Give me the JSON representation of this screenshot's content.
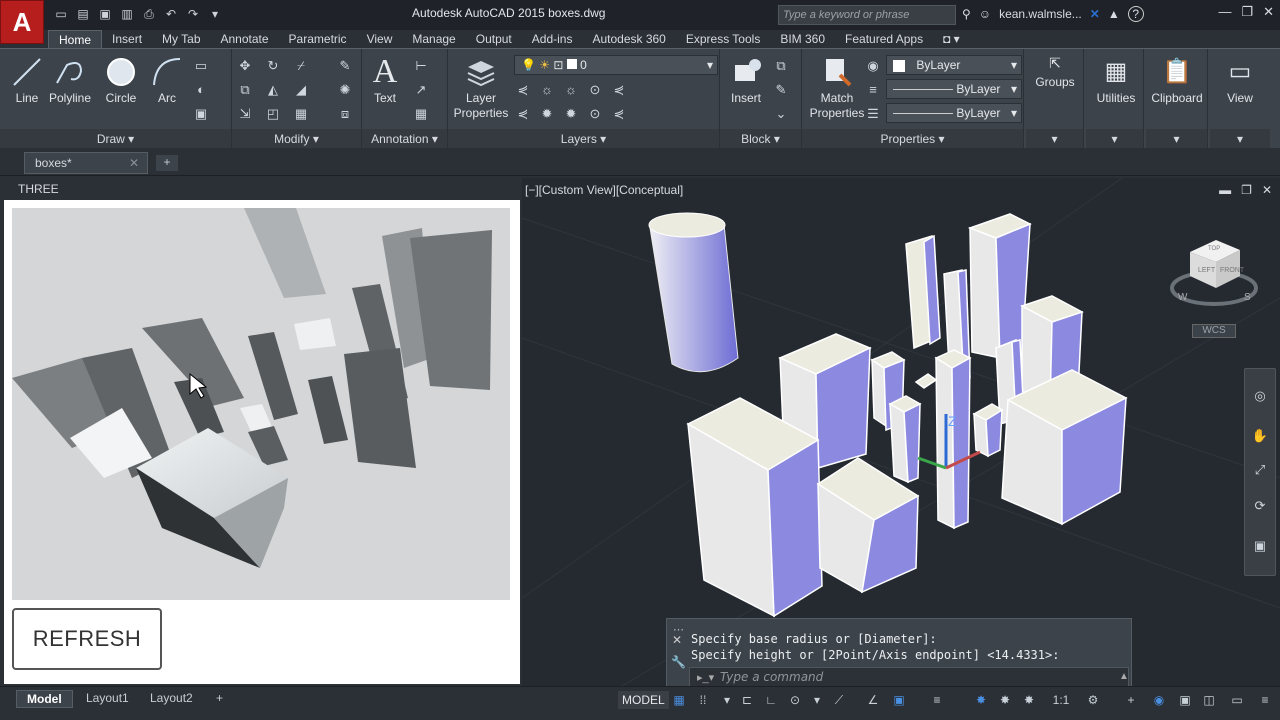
{
  "app": {
    "title": "Autodesk AutoCAD 2015    boxes.dwg",
    "logo_letter": "A",
    "search_placeholder": "Type a keyword or phrase",
    "user": "kean.walmsle...",
    "help": "?"
  },
  "ribbon_tabs": [
    "Home",
    "Insert",
    "My Tab",
    "Annotate",
    "Parametric",
    "View",
    "Manage",
    "Output",
    "Add-ins",
    "Autodesk 360",
    "Express Tools",
    "BIM 360",
    "Featured Apps"
  ],
  "ribbon": {
    "draw": {
      "title": "Draw",
      "line": "Line",
      "polyline": "Polyline",
      "circle": "Circle",
      "arc": "Arc"
    },
    "modify": {
      "title": "Modify"
    },
    "annotation": {
      "title": "Annotation",
      "text": "Text"
    },
    "layers": {
      "title": "Layers",
      "layer_properties": "Layer\nProperties",
      "current_layer": "0"
    },
    "block": {
      "title": "Block",
      "insert": "Insert"
    },
    "properties": {
      "title": "Properties",
      "match": "Match\nProperties",
      "color": "ByLayer",
      "linetype": "ByLayer",
      "lineweight": "ByLayer"
    },
    "groups": "Groups",
    "utilities": "Utilities",
    "clipboard": "Clipboard",
    "view": "View"
  },
  "doc_tab": "boxes*",
  "palette": {
    "title": "THREE",
    "refresh_label": "REFRESH"
  },
  "viewport": {
    "label": "[−][Custom View][Conceptual]",
    "wcs": "WCS"
  },
  "command": {
    "history": [
      "Specify base radius or [Diameter]:",
      "Specify height or [2Point/Axis endpoint] <14.4331>:"
    ],
    "placeholder": "Type a command"
  },
  "status": {
    "layout_tabs": [
      "Model",
      "Layout1",
      "Layout2"
    ],
    "model_button": "MODEL",
    "scale": "1:1"
  },
  "colors": {
    "box_side": "#8c8ae0",
    "box_top": "#ecebdf",
    "box_front": "#e6e6e6",
    "accent_red": "#b61d1d"
  }
}
